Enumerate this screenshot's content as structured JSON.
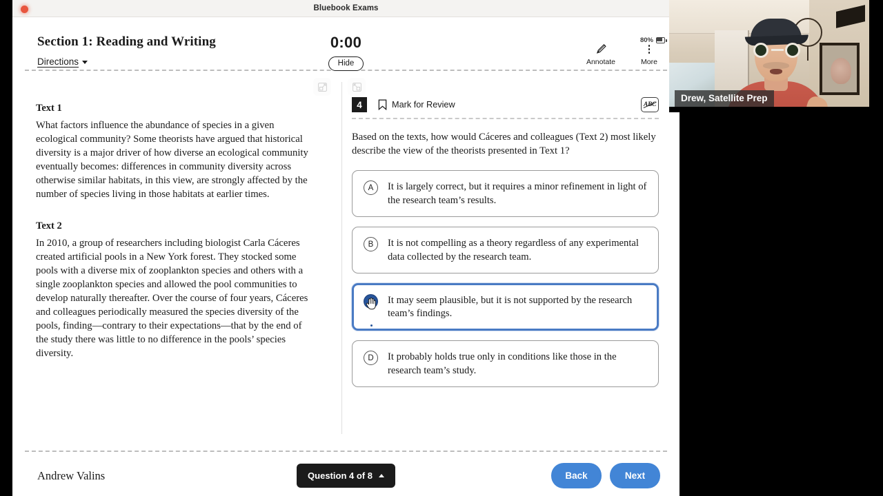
{
  "window": {
    "title": "Bluebook Exams",
    "recording_indicator": "recording-dot"
  },
  "header": {
    "section_title": "Section 1: Reading and Writing",
    "directions_label": "Directions",
    "timer": "0:00",
    "hide_button": "Hide",
    "annotate_label": "Annotate",
    "more_label": "More",
    "battery_percent": "80%"
  },
  "passages": [
    {
      "heading": "Text 1",
      "body": "What factors influence the abundance of species in a given ecological community? Some theorists have argued that historical diversity is a major driver of how diverse an ecological community eventually becomes: differences in community diversity across otherwise similar habitats, in this view, are strongly affected by the number of species living in those habitats at earlier times."
    },
    {
      "heading": "Text 2",
      "body": "In 2010, a group of researchers including biologist Carla Cáceres created artificial pools in a New York forest. They stocked some pools with a diverse mix of zooplankton species and others with a single zooplankton species and allowed the pool communities to develop naturally thereafter. Over the course of four years, Cáceres and colleagues periodically measured the species diversity of the pools, finding—contrary to their expectations—that by the end of the study there was little to no difference in the pools’ species diversity."
    }
  ],
  "question": {
    "number": "4",
    "mark_for_review": "Mark for Review",
    "eliminator_label": "ABC",
    "stem": "Based on the texts, how would Cáceres and colleagues (Text 2) most likely describe the view of the theorists presented in Text 1?",
    "choices": [
      {
        "letter": "A",
        "text": "It is largely correct, but it requires a minor refinement in light of the research team’s results.",
        "selected": false
      },
      {
        "letter": "B",
        "text": "It is not compelling as a theory regardless of any experimental data collected by the research team.",
        "selected": false
      },
      {
        "letter": "C",
        "text": "It may seem plausible, but it is not supported by the research team’s findings.",
        "selected": true
      },
      {
        "letter": "D",
        "text": "It probably holds true only in conditions like those in the research team’s study.",
        "selected": false
      }
    ]
  },
  "footer": {
    "student_name": "Andrew Valins",
    "question_nav": "Question 4 of 8",
    "back_button": "Back",
    "next_button": "Next"
  },
  "video": {
    "presenter_label": "Drew, Satellite Prep"
  },
  "colors": {
    "accent_blue": "#4285d6",
    "selected_border": "#4a7bc4",
    "selected_bubble": "#27549a",
    "dark": "#1b1b1b",
    "recording_dot": "#e8563f"
  }
}
